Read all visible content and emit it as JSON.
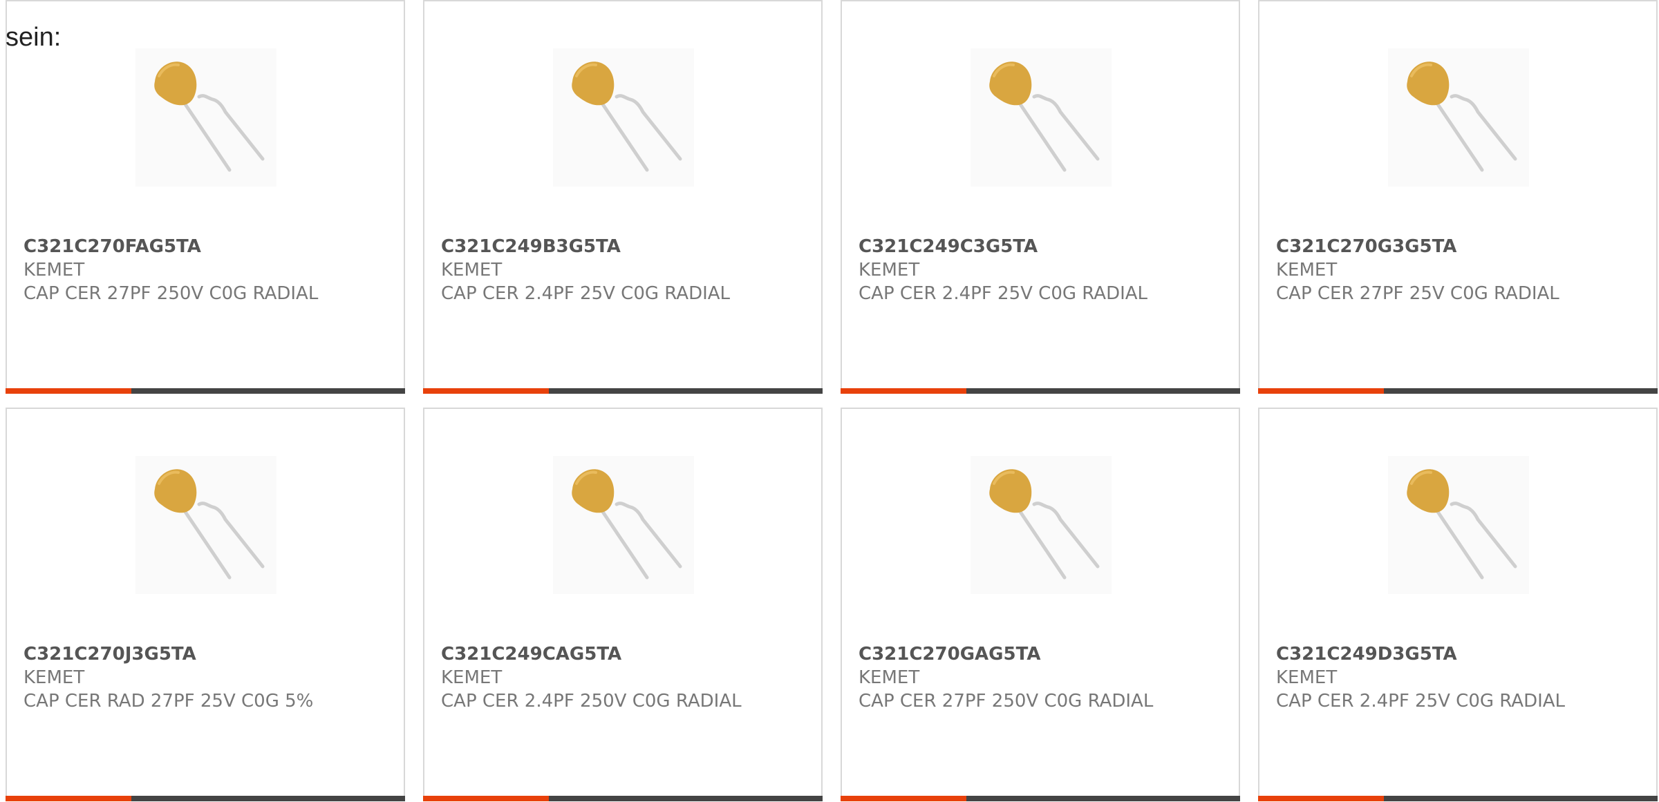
{
  "intro_text": "sein:",
  "colors": {
    "accent": "#e8410b",
    "bar_dark": "#444444",
    "capacitor_body": "#d9a640",
    "lead": "#cfcfcf"
  },
  "products": [
    {
      "part_number": "C321C270FAG5TA",
      "manufacturer": "KEMET",
      "description": "CAP CER 27PF 250V C0G RADIAL"
    },
    {
      "part_number": "C321C249B3G5TA",
      "manufacturer": "KEMET",
      "description": "CAP CER 2.4PF 25V C0G RADIAL"
    },
    {
      "part_number": "C321C249C3G5TA",
      "manufacturer": "KEMET",
      "description": "CAP CER 2.4PF 25V C0G RADIAL"
    },
    {
      "part_number": "C321C270G3G5TA",
      "manufacturer": "KEMET",
      "description": "CAP CER 27PF 25V C0G RADIAL"
    },
    {
      "part_number": "C321C270J3G5TA",
      "manufacturer": "KEMET",
      "description": "CAP CER RAD 27PF 25V C0G 5%"
    },
    {
      "part_number": "C321C249CAG5TA",
      "manufacturer": "KEMET",
      "description": "CAP CER 2.4PF 250V C0G RADIAL"
    },
    {
      "part_number": "C321C270GAG5TA",
      "manufacturer": "KEMET",
      "description": "CAP CER 27PF 250V C0G RADIAL"
    },
    {
      "part_number": "C321C249D3G5TA",
      "manufacturer": "KEMET",
      "description": "CAP CER 2.4PF 25V C0G RADIAL"
    }
  ],
  "product_image_icon": "radial-ceramic-capacitor-icon"
}
